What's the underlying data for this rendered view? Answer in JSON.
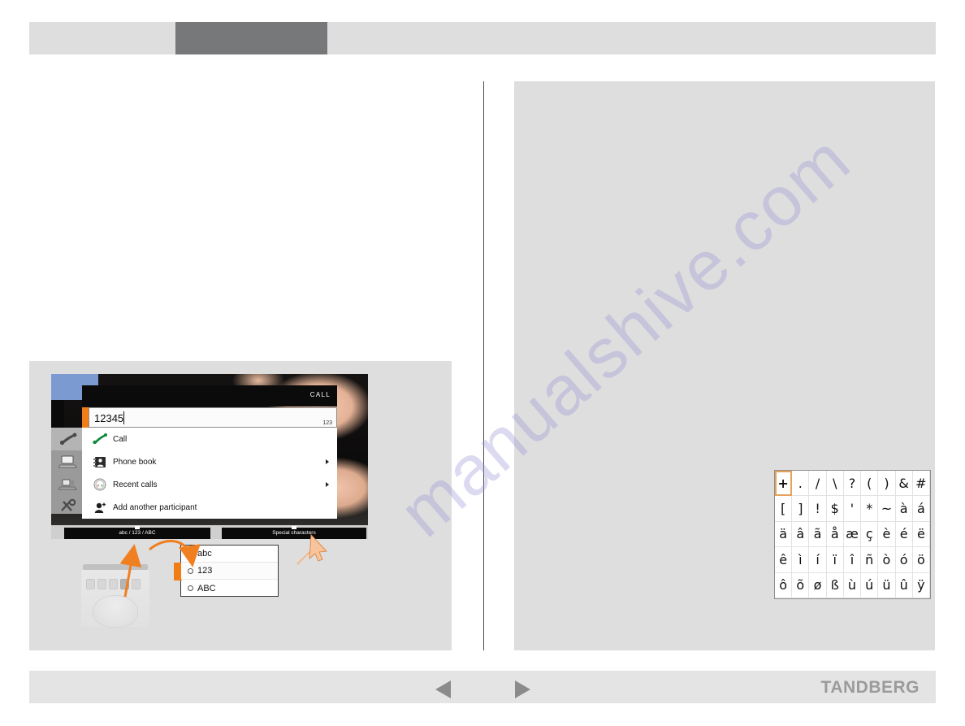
{
  "header": {
    "tab_label": "",
    "left_label": "",
    "right_label": ""
  },
  "watermark": {
    "text": "manualshive.com"
  },
  "device": {
    "title": "CALL",
    "input": {
      "value": "12345",
      "mode_indicator": "123"
    },
    "menu": [
      {
        "label": "Call",
        "icon": "green-handset-icon",
        "has_submenu": false
      },
      {
        "label": "Phone book",
        "icon": "contact-card-icon",
        "has_submenu": true
      },
      {
        "label": "Recent calls",
        "icon": "recent-calls-icon",
        "has_submenu": true
      },
      {
        "label": "Add another participant",
        "icon": "add-person-icon",
        "has_submenu": false
      }
    ],
    "sidebar_icons": [
      "handset-icon",
      "presentation-icon",
      "laptop-share-icon",
      "tools-icon"
    ],
    "softkeys": [
      {
        "label": "abc / 123 / ABC"
      },
      {
        "label": "Special characters"
      }
    ]
  },
  "popup": {
    "options": [
      {
        "label": "abc",
        "selected": true,
        "highlighted": false
      },
      {
        "label": "123",
        "selected": false,
        "highlighted": true
      },
      {
        "label": "ABC",
        "selected": false,
        "highlighted": false
      }
    ]
  },
  "charmap": {
    "selected": "+",
    "rows": [
      [
        "+",
        ".",
        "/",
        "\\",
        "?",
        "(",
        ")",
        "&",
        "#"
      ],
      [
        "[",
        "]",
        "!",
        "$",
        "'",
        "*",
        "~",
        "à",
        "á"
      ],
      [
        "ä",
        "â",
        "ã",
        "å",
        "æ",
        "ç",
        "è",
        "é",
        "ë"
      ],
      [
        "ê",
        "ì",
        "í",
        "ï",
        "î",
        "ñ",
        "ò",
        "ó",
        "ö"
      ],
      [
        "ô",
        "õ",
        "ø",
        "ß",
        "ù",
        "ú",
        "ü",
        "û",
        "ÿ"
      ]
    ]
  },
  "footer": {
    "prev_label": "Previous page",
    "next_label": "Next page",
    "brand": "TANDBERG"
  },
  "colors": {
    "accent_orange": "#f07d16",
    "panel_gray": "#dedede",
    "tab_gray": "#77787a",
    "brand_gray": "#9b9b9b",
    "watermark_purple": "#9694d7"
  }
}
